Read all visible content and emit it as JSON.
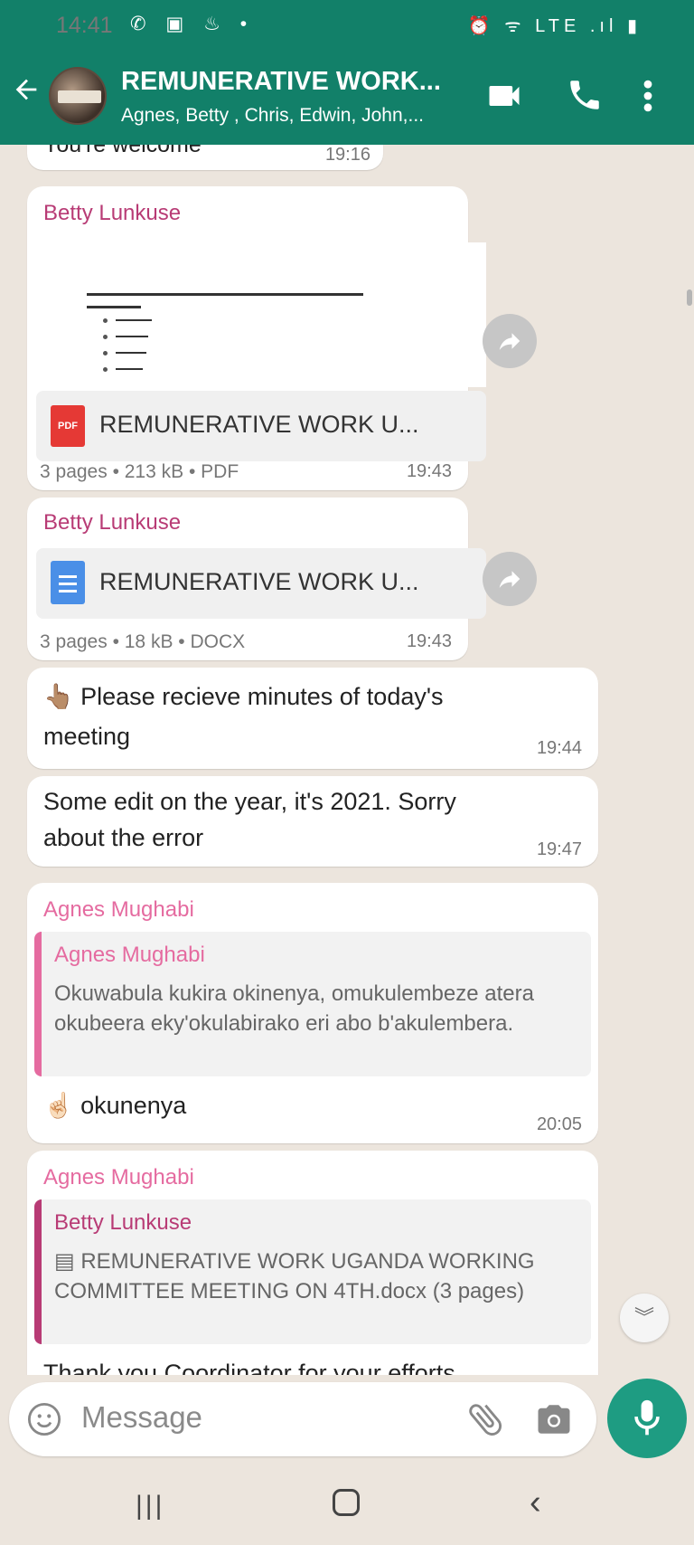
{
  "status_bar": {
    "time": "14:41",
    "left_icons": "✆ ▣ ♨ •",
    "right_icons": "⏰ ᯤ LTE .ıl ▮"
  },
  "header": {
    "title": "REMUNERATIVE WORK...",
    "subtitle": "Agnes, Betty , Chris, Edwin, John,..."
  },
  "messages": {
    "m0": {
      "text": "You're welcome",
      "time": "19:16"
    },
    "m1": {
      "sender": "Betty Lunkuse",
      "file_name": "REMUNERATIVE WORK U...",
      "file_icon": "PDF",
      "meta": "3 pages • 213 kB • PDF",
      "time": "19:43"
    },
    "m2": {
      "sender": "Betty Lunkuse",
      "file_name": "REMUNERATIVE WORK U...",
      "meta": "3 pages • 18 kB • DOCX",
      "time": "19:43"
    },
    "m3": {
      "emoji": "👆🏽",
      "text_line1": "Please recieve minutes of today's",
      "text_line2": "meeting",
      "time": "19:44"
    },
    "m4": {
      "text_line1": "Some edit on the year, it's 2021. Sorry",
      "text_line2": "about the error",
      "time": "19:47"
    },
    "m5": {
      "sender": "Agnes Mughabi",
      "quote_sender": "Agnes Mughabi",
      "quote_text": "Okuwabula kukira okinenya, omukulembeze atera okubeera eky'okulabirako eri abo b'akulembera.",
      "emoji": "☝🏻",
      "text": "okunenya",
      "time": "20:05"
    },
    "m6": {
      "sender": "Agnes Mughabi",
      "quote_sender": "Betty Lunkuse",
      "quote_text": "▤ REMUNERATIVE WORK UGANDA WORKING COMMITTEE MEETING ON 4TH.docx (3 pages)",
      "text": "Thank you Coordinator for your efforts"
    }
  },
  "composer": {
    "placeholder": "Message"
  },
  "colors": {
    "header": "#128069",
    "accent": "#1e9c82",
    "sender_betty": "#b83b75",
    "sender_agnes": "#e56ba0"
  }
}
